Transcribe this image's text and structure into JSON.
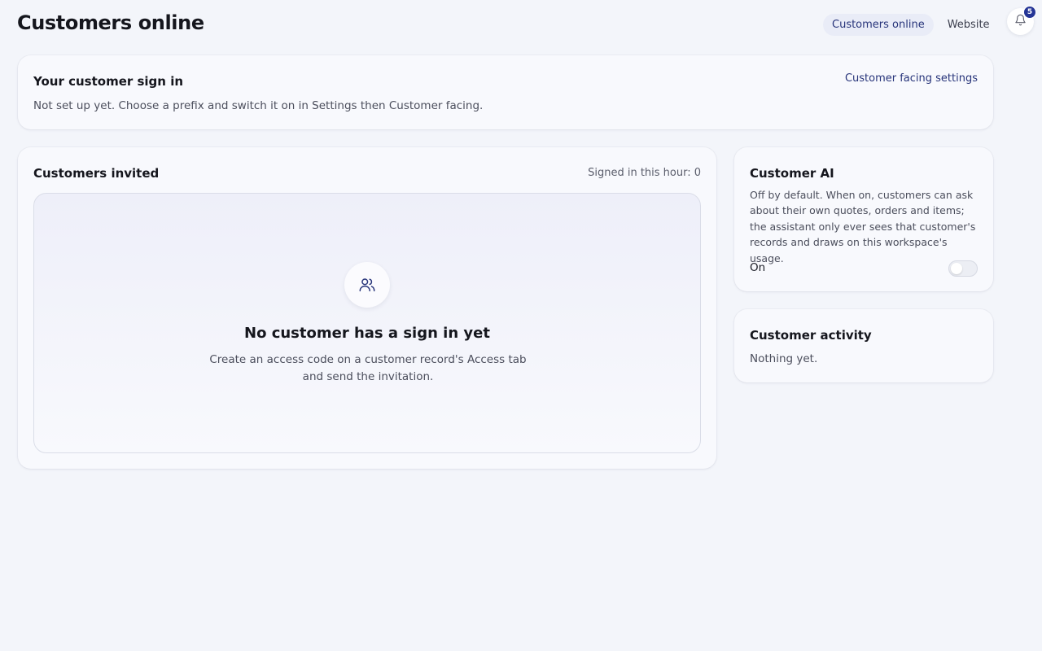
{
  "page": {
    "title": "Customers online"
  },
  "nav": {
    "tabs": [
      {
        "label": "Customers online",
        "active": true
      },
      {
        "label": "Website",
        "active": false
      }
    ],
    "notifications": {
      "icon": "bell-icon",
      "count": "5"
    }
  },
  "signin": {
    "title": "Your customer sign in",
    "text": "Not set up yet. Choose a prefix and switch it on in Settings then Customer facing.",
    "settings_link": "Customer facing settings"
  },
  "invited": {
    "title": "Customers invited",
    "signed_in_hour": "Signed in this hour: 0",
    "empty": {
      "icon": "users-icon",
      "title": "No customer has a sign in yet",
      "text": "Create an access code on a customer record's Access tab and send the invitation."
    }
  },
  "ai": {
    "title": "Customer AI",
    "text": "Off by default. When on, customers can ask about their own quotes, orders and items; the assistant only ever sees that customer's records and draws on this workspace's usage.",
    "toggle_label": "On",
    "toggle_on": false
  },
  "activity": {
    "title": "Customer activity",
    "text": "Nothing yet."
  },
  "colors": {
    "accent": "#27347a",
    "badge": "#253596",
    "background": "#f3f5fa"
  }
}
